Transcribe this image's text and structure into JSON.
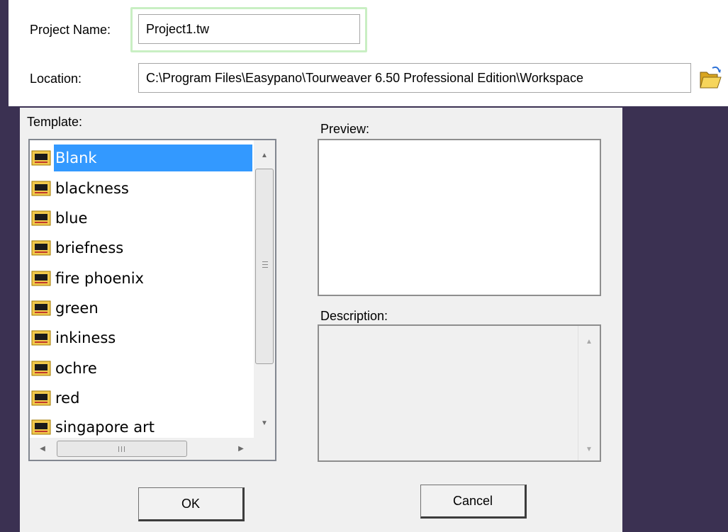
{
  "project": {
    "name_label": "Project Name:",
    "name_value": "Project1.tw"
  },
  "location": {
    "label": "Location:",
    "value": "C:\\Program Files\\Easypano\\Tourweaver 6.50 Professional Edition\\Workspace",
    "browse_icon": "folder-open-icon"
  },
  "template": {
    "label": "Template:",
    "items": [
      "Blank",
      "blackness",
      "blue",
      "briefness",
      "fire phoenix",
      "green",
      "inkiness",
      "ochre",
      "red",
      "singapore art"
    ],
    "selected": "Blank",
    "item_icon": "template-icon"
  },
  "preview": {
    "label": "Preview:"
  },
  "description": {
    "label": "Description:"
  },
  "buttons": {
    "ok": "OK",
    "cancel": "Cancel"
  },
  "colors": {
    "selection": "#3399ff",
    "background": "#3b3152",
    "focus_ring": "#c9efc3"
  }
}
